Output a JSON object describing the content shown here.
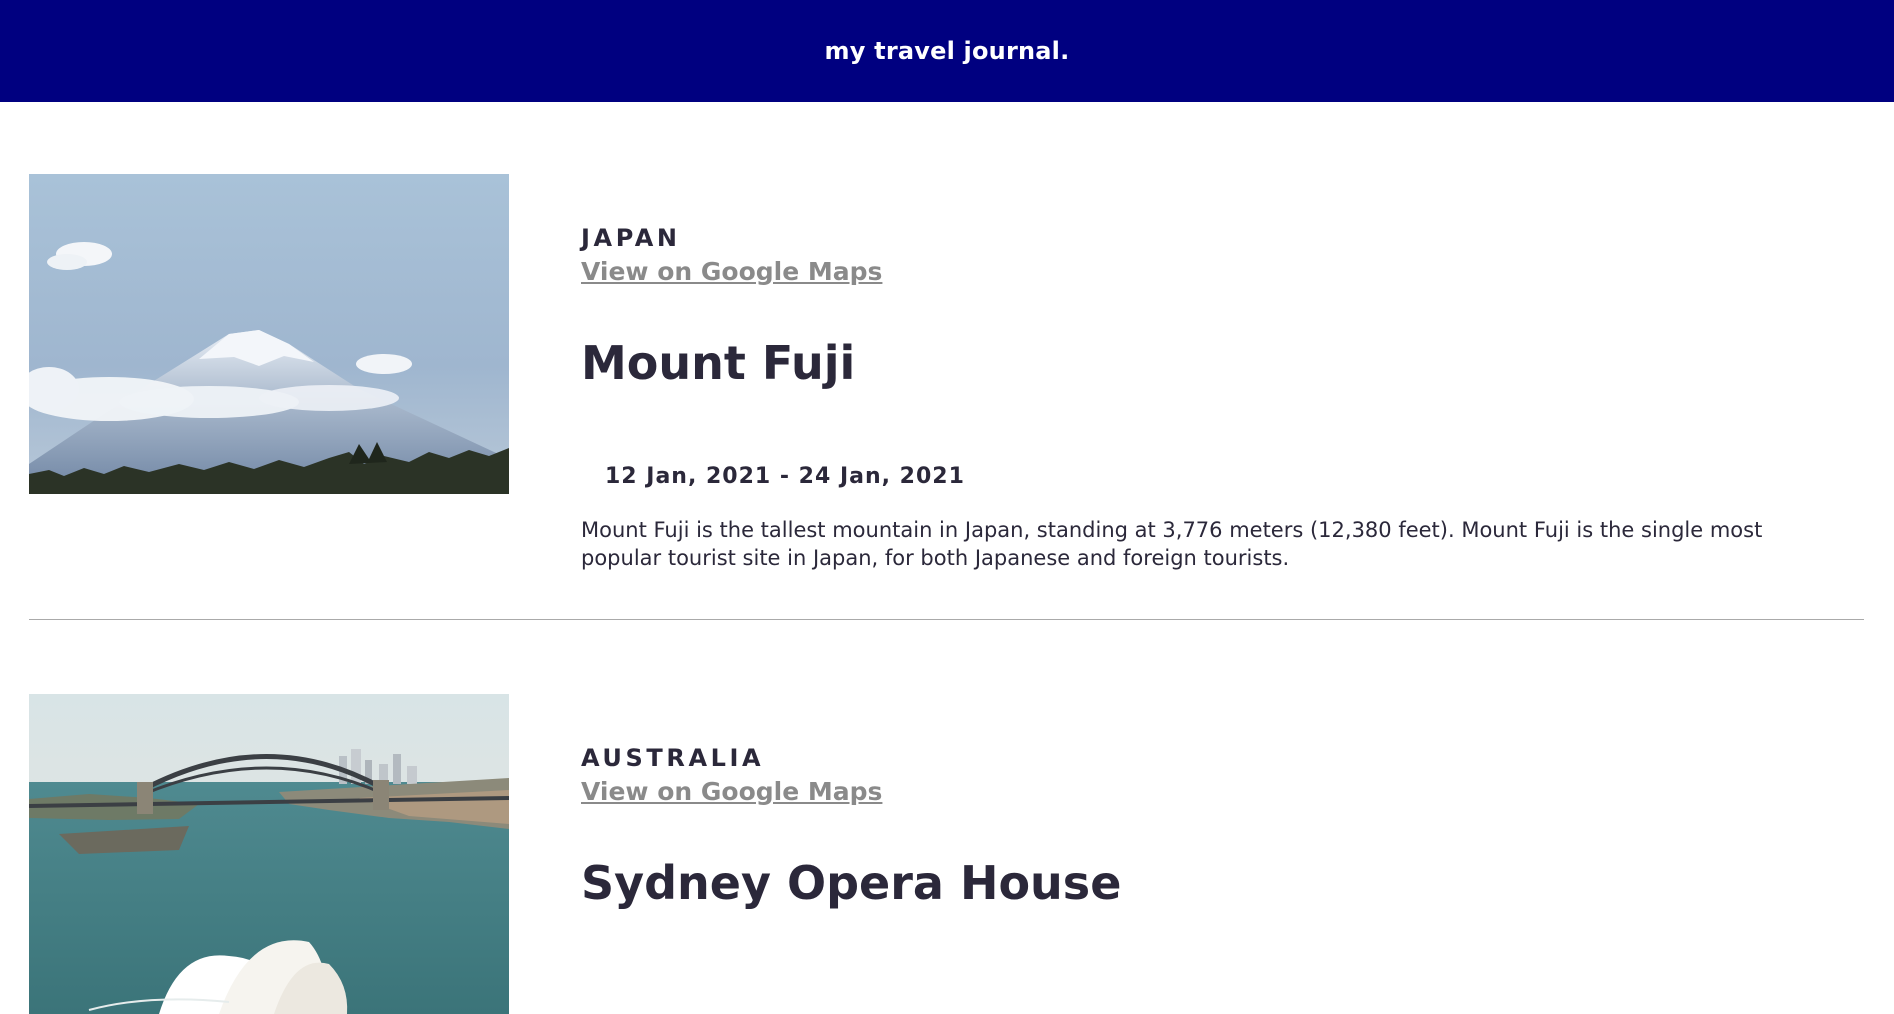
{
  "header": {
    "title": "my travel journal."
  },
  "entries": [
    {
      "country": "JAPAN",
      "maps_link": "View on Google Maps",
      "title": "Mount Fuji",
      "dates": "12 Jan, 2021 - 24 Jan, 2021",
      "description": "Mount Fuji is the tallest mountain in Japan, standing at 3,776 meters (12,380 feet). Mount Fuji is the single most popular tourist site in Japan, for both Japanese and foreign tourists.",
      "image": "mount-fuji-photo"
    },
    {
      "country": "AUSTRALIA",
      "maps_link": "View on Google Maps",
      "title": "Sydney Opera House",
      "image": "sydney-harbour-photo"
    }
  ],
  "colors": {
    "header_bg": "#000080",
    "text": "#2b283a",
    "link": "#8a8a8a",
    "divider": "#aaaaaa"
  }
}
